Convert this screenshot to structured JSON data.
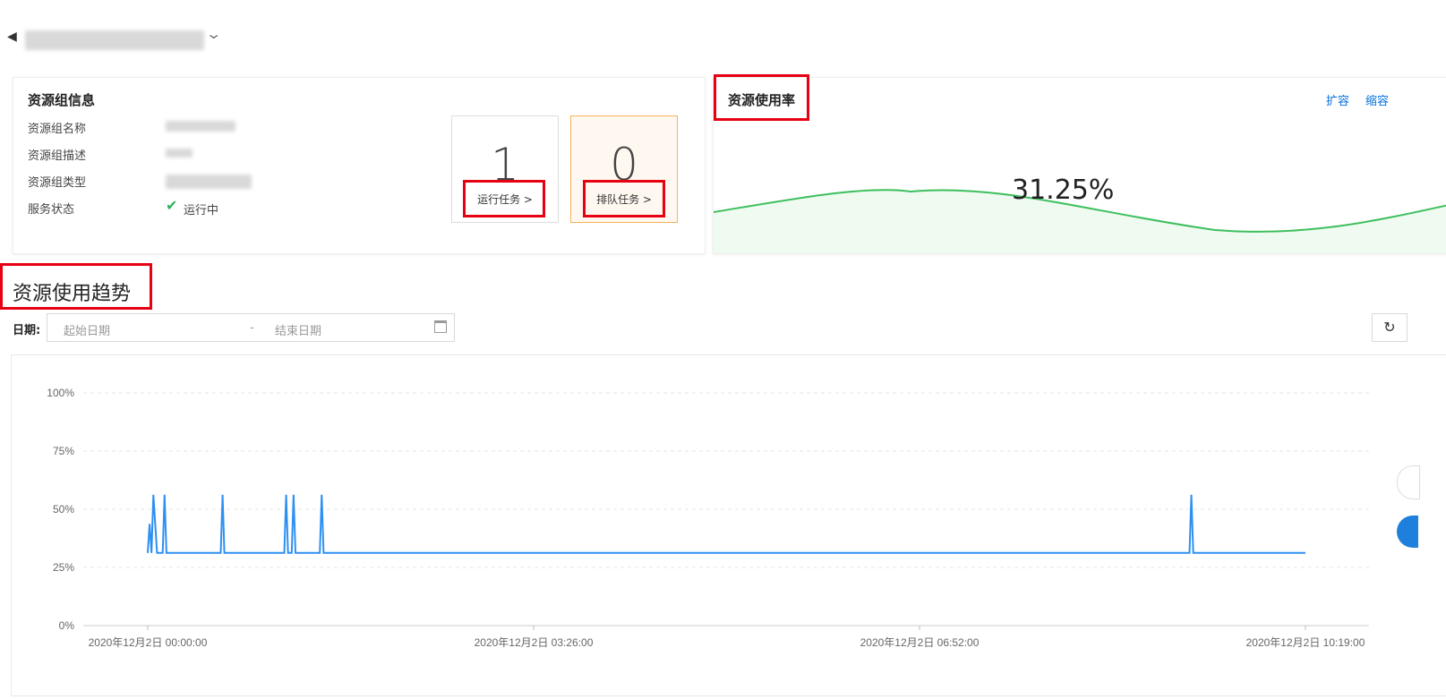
{
  "header": {
    "back_icon": "arrow-left-icon",
    "chevron_icon": "chevron-down-icon"
  },
  "info_card": {
    "title": "资源组信息",
    "rows": [
      {
        "label": "资源组名称"
      },
      {
        "label": "资源组描述"
      },
      {
        "label": "资源组类型"
      },
      {
        "label": "服务状态",
        "value": "运行中"
      }
    ],
    "running": {
      "count": "1",
      "link": "运行任务 >"
    },
    "queued": {
      "count": "0",
      "link": "排队任务 >"
    }
  },
  "usage_card": {
    "title": "资源使用率",
    "expand": "扩容",
    "shrink": "缩容",
    "percent": "31.25%",
    "wave_color": "#3dbf5c",
    "fill_color": "#effaf1"
  },
  "trend": {
    "title": "资源使用趋势",
    "date_label": "日期:",
    "start_placeholder": "起始日期",
    "separator": "-",
    "end_placeholder": "结束日期",
    "calendar_icon": "calendar-icon",
    "refresh_icon": "refresh-icon"
  },
  "chart_data": {
    "type": "line",
    "line_color": "#2e90f2",
    "yticks": [
      "100%",
      "75%",
      "50%",
      "25%",
      "0%"
    ],
    "ylim": [
      0,
      100
    ],
    "xticks": [
      "2020年12月2日 00:00:00",
      "2020年12月2日 03:26:00",
      "2020年12月2日 06:52:00",
      "2020年12月2日 10:19:00"
    ],
    "series": [
      {
        "x_minutes": [
          0,
          1,
          2,
          3,
          5,
          6,
          8,
          9,
          10,
          11,
          39,
          40,
          41,
          73,
          74,
          75,
          77,
          78,
          79,
          92,
          93,
          94,
          557,
          558,
          559,
          619
        ],
        "values": [
          31.25,
          43.75,
          31.25,
          56.25,
          31.25,
          31.25,
          31.25,
          56.25,
          31.25,
          31.25,
          31.25,
          56.25,
          31.25,
          31.25,
          56.25,
          31.25,
          31.25,
          56.25,
          31.25,
          31.25,
          56.25,
          31.25,
          31.25,
          56.25,
          31.25,
          31.25
        ]
      }
    ]
  }
}
